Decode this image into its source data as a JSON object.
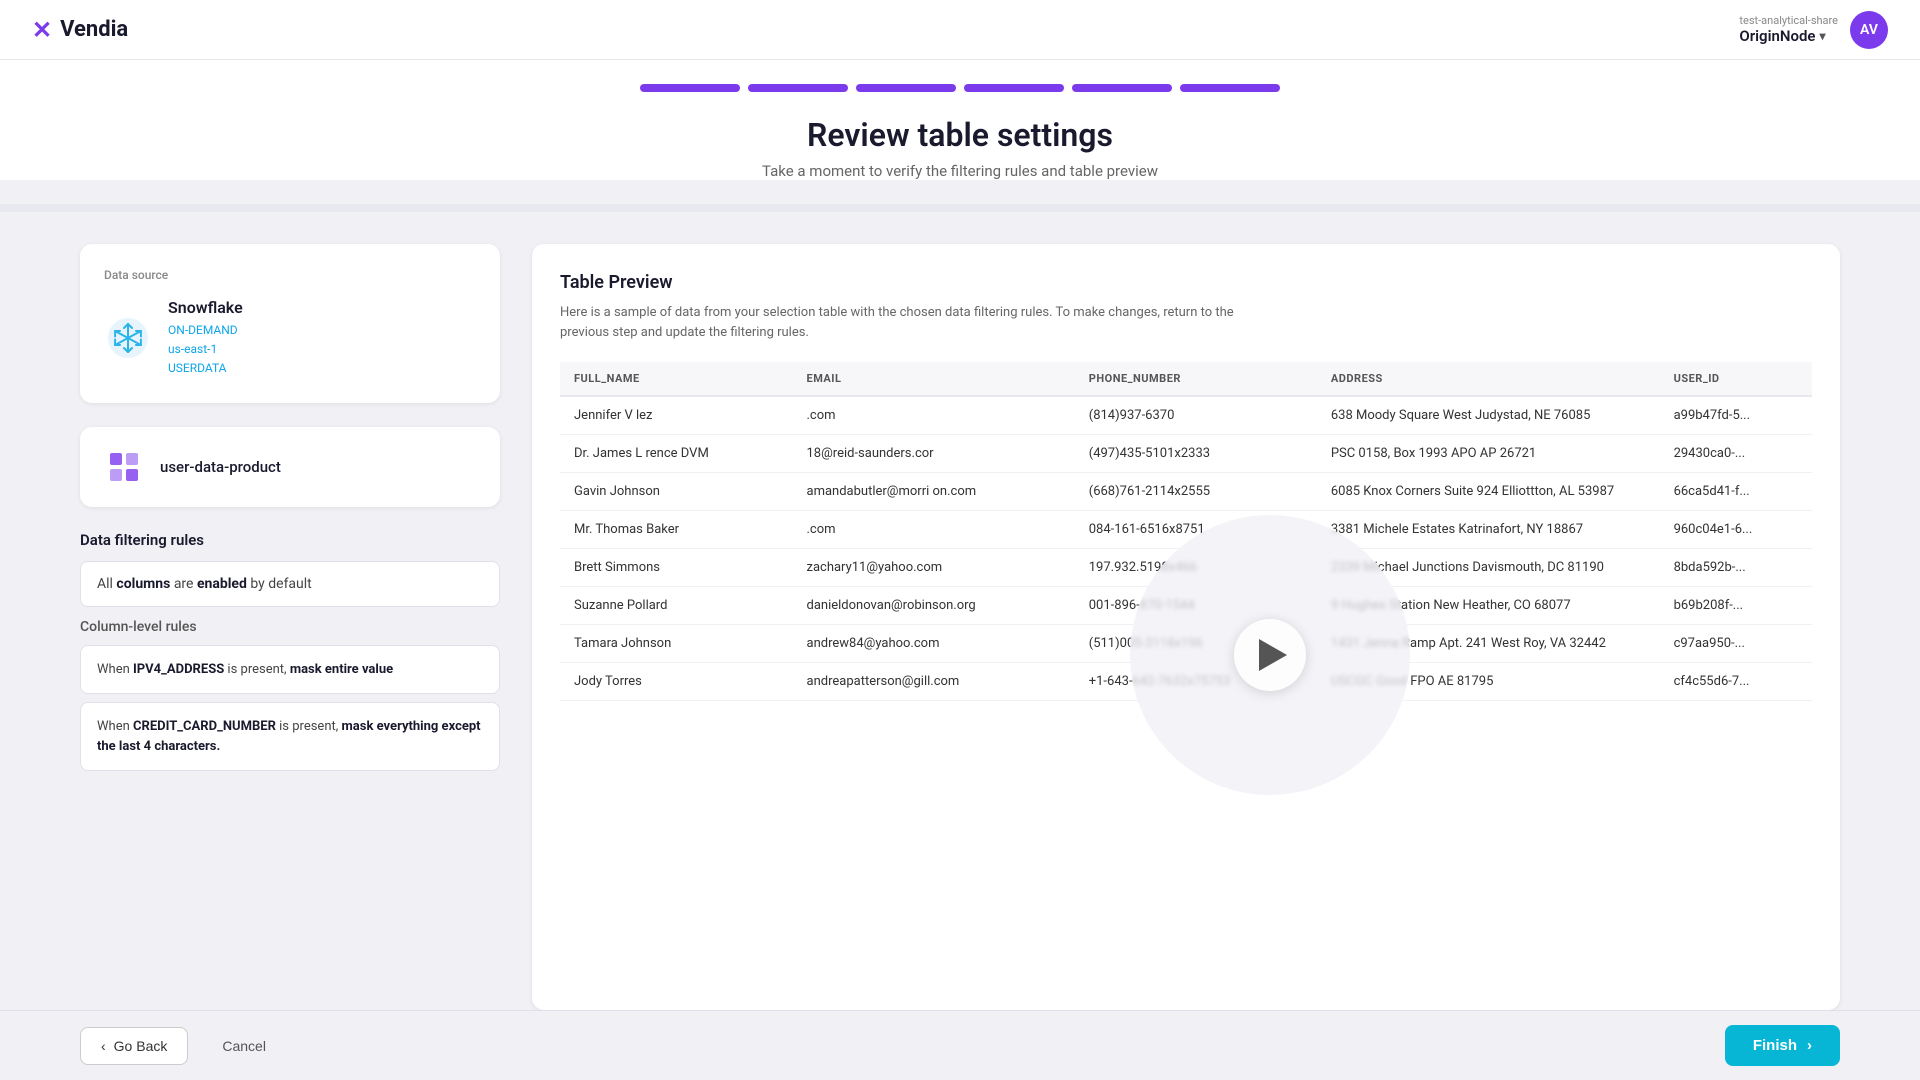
{
  "header": {
    "logo_text": "Vendia",
    "origin_node_label": "test-analytical-share",
    "origin_node_name": "OriginNode",
    "avatar_initials": "AV"
  },
  "progress": {
    "steps": 6,
    "title": "Review table settings",
    "subtitle": "Take a moment to verify the filtering rules and table preview"
  },
  "left_panel": {
    "data_source_label": "Data source",
    "snowflake_name": "Snowflake",
    "snowflake_meta": [
      "ON-DEMAND",
      "us-east-1",
      "USERDATA"
    ],
    "data_product_name": "user-data-product",
    "filtering_title": "Data filtering rules",
    "default_rule": {
      "prefix": "All",
      "bold1": "columns",
      "middle": "are",
      "bold2": "enabled",
      "suffix": "by default"
    },
    "col_rules_title": "Column-level rules",
    "col_rules": [
      {
        "prefix": "When",
        "bold1": "IPV4_ADDRESS",
        "middle": "is present,",
        "bold2": "mask entire value"
      },
      {
        "prefix": "When",
        "bold1": "CREDIT_CARD_NUMBER",
        "middle": "is present,",
        "bold2": "mask\neverything except the last",
        "bold3": "4",
        "suffix": "characters."
      }
    ]
  },
  "table_preview": {
    "title": "Table Preview",
    "description": "Here is a sample of data from your selection table with the chosen data filtering rules. To make changes, return to the previous step and update the filtering rules.",
    "columns": [
      "FULL_NAME",
      "EMAIL",
      "PHONE_NUMBER",
      "ADDRESS",
      "USER_ID"
    ],
    "rows": [
      [
        "Jennifer V  lez",
        "              .com",
        "(814)937-6370",
        "638 Moody Square West Judystad, NE 76085",
        "a99b47fd-5..."
      ],
      [
        "Dr. James L  rence DVM",
        "    18@reid-saunders.cor",
        "(497)435-5101x2333",
        "PSC 0158, Box 1993 APO AP 26721",
        "29430ca0-..."
      ],
      [
        "Gavin Johnson",
        "amandabutler@morri  on.com",
        "(668)761-2114x2555",
        "6085 Knox Corners Suite 924 Elliottton, AL 53987",
        "66ca5d41-f..."
      ],
      [
        "Mr. Thomas Baker",
        "          .com",
        "084-161-6516x8751",
        "3381 Michele Estates Katrinafort, NY 18867",
        "960c04e1-6..."
      ],
      [
        "Brett Simmons",
        "zachary11@yahoo.com",
        "197.932.5198x466",
        "2339 Michael Junctions Davismouth, DC 81190",
        "8bda592b-..."
      ],
      [
        "Suzanne Pollard",
        "danieldonovan@robinson.org",
        "001-896-870-1544",
        "9    Hughes Station New Heather, CO 68077",
        "b69b208f-..."
      ],
      [
        "Tamara Johnson",
        "andrew84@yahoo.com",
        "(511)005-3118x196",
        "1431 Jenna Ramp Apt. 241 West Roy, VA 32442",
        "c97aa950-..."
      ],
      [
        "Jody Torres",
        "andreapatterson@gill.com",
        "+1-643-642-7632x75753",
        "USCGC Good FPO AE 81795",
        "cf4c55d6-7..."
      ]
    ]
  },
  "footer": {
    "go_back_label": "Go Back",
    "cancel_label": "Cancel",
    "finish_label": "Finish"
  }
}
